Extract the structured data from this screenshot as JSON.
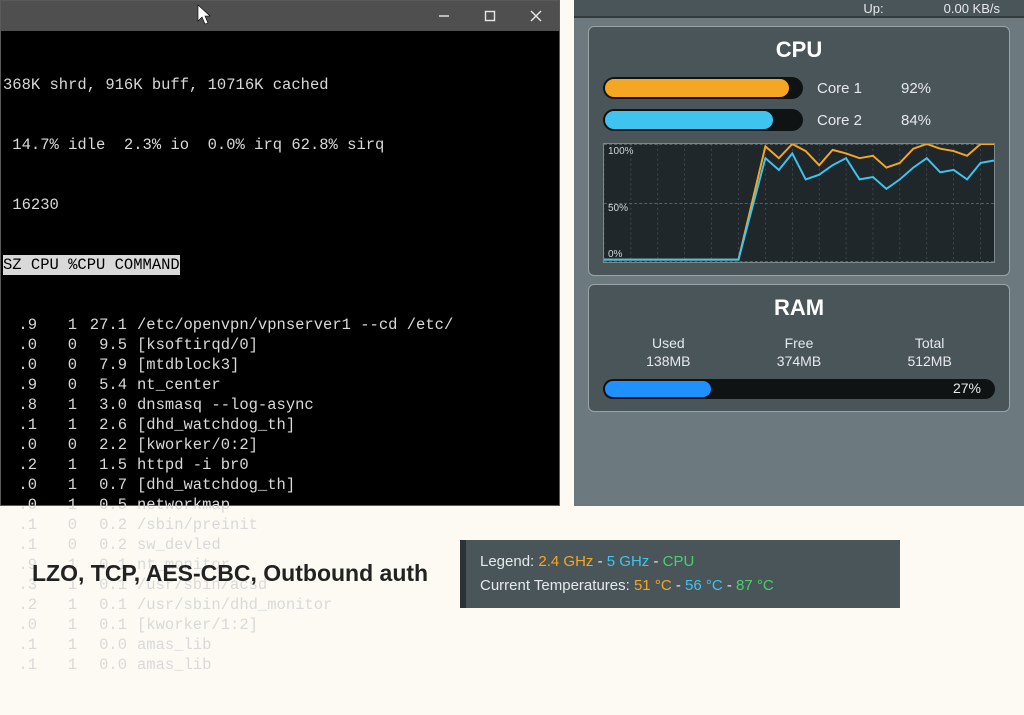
{
  "terminal": {
    "mem_line": "368K shrd, 916K buff, 10716K cached",
    "cpu_line": " 14.7% idle  2.3% io  0.0% irq 62.8% sirq",
    "pid_line": " 16230",
    "header": "SZ CPU %CPU COMMAND",
    "procs": [
      {
        "sz": ".9",
        "cpu": "1",
        "pct": "27.1",
        "cmd": "/etc/openvpn/vpnserver1 --cd /etc/"
      },
      {
        "sz": ".0",
        "cpu": "0",
        "pct": "9.5",
        "cmd": "[ksoftirqd/0]"
      },
      {
        "sz": ".0",
        "cpu": "0",
        "pct": "7.9",
        "cmd": "[mtdblock3]"
      },
      {
        "sz": ".9",
        "cpu": "0",
        "pct": "5.4",
        "cmd": "nt_center"
      },
      {
        "sz": ".8",
        "cpu": "1",
        "pct": "3.0",
        "cmd": "dnsmasq --log-async"
      },
      {
        "sz": ".1",
        "cpu": "1",
        "pct": "2.6",
        "cmd": "[dhd_watchdog_th]"
      },
      {
        "sz": ".0",
        "cpu": "0",
        "pct": "2.2",
        "cmd": "[kworker/0:2]"
      },
      {
        "sz": ".2",
        "cpu": "1",
        "pct": "1.5",
        "cmd": "httpd -i br0"
      },
      {
        "sz": ".0",
        "cpu": "1",
        "pct": "0.7",
        "cmd": "[dhd_watchdog_th]"
      },
      {
        "sz": ".0",
        "cpu": "1",
        "pct": "0.5",
        "cmd": "networkmap"
      },
      {
        "sz": ".1",
        "cpu": "0",
        "pct": "0.2",
        "cmd": "/sbin/preinit"
      },
      {
        "sz": ".1",
        "cpu": "0",
        "pct": "0.2",
        "cmd": "sw_devled"
      },
      {
        "sz": ".9",
        "cpu": "1",
        "pct": "0.1",
        "cmd": "nt_monitor"
      },
      {
        "sz": ".3",
        "cpu": "1",
        "pct": "0.1",
        "cmd": "/usr/sbin/acsd"
      },
      {
        "sz": ".2",
        "cpu": "1",
        "pct": "0.1",
        "cmd": "/usr/sbin/dhd_monitor"
      },
      {
        "sz": ".0",
        "cpu": "1",
        "pct": "0.1",
        "cmd": "[kworker/1:2]"
      },
      {
        "sz": ".1",
        "cpu": "1",
        "pct": "0.0",
        "cmd": "amas_lib"
      },
      {
        "sz": ".1",
        "cpu": "1",
        "pct": "0.0",
        "cmd": "amas_lib"
      }
    ]
  },
  "cpu": {
    "title": "CPU",
    "cores": [
      {
        "name": "Core 1",
        "pct": 92,
        "color": "orange"
      },
      {
        "name": "Core 2",
        "pct": 84,
        "color": "blue"
      }
    ]
  },
  "chart_data": {
    "type": "line",
    "ylim": [
      0,
      100
    ],
    "yticks": [
      "100%",
      "50%",
      "0%"
    ],
    "x": [
      0,
      1,
      2,
      3,
      4,
      5,
      6,
      7,
      8,
      9,
      10,
      11,
      12,
      13,
      14,
      15,
      16,
      17,
      18,
      19,
      20,
      21,
      22,
      23,
      24,
      25,
      26,
      27,
      28,
      29
    ],
    "series": [
      {
        "name": "Core 1",
        "color": "#f5a623",
        "values": [
          2,
          2,
          2,
          2,
          2,
          2,
          2,
          2,
          2,
          2,
          2,
          50,
          98,
          88,
          100,
          94,
          82,
          95,
          92,
          88,
          90,
          80,
          84,
          96,
          100,
          96,
          94,
          90,
          100,
          100
        ]
      },
      {
        "name": "Core 2",
        "color": "#3fc4ef",
        "values": [
          2,
          2,
          2,
          2,
          2,
          2,
          2,
          2,
          2,
          2,
          2,
          45,
          88,
          78,
          92,
          70,
          74,
          82,
          88,
          70,
          72,
          62,
          70,
          80,
          88,
          76,
          78,
          70,
          84,
          86
        ]
      }
    ]
  },
  "ram": {
    "title": "RAM",
    "used_label": "Used",
    "used": "138MB",
    "free_label": "Free",
    "free": "374MB",
    "total_label": "Total",
    "total": "512MB",
    "pct": 27
  },
  "topstrip": {
    "up_label": "Up:",
    "rate": "0.00 KB/s"
  },
  "caption": "LZO, TCP, AES-CBC, Outbound auth",
  "legend": {
    "label": "Legend:",
    "items": [
      {
        "text": "2.4 GHz",
        "cls": "c-orange"
      },
      {
        "text": "5 GHz",
        "cls": "c-blue"
      },
      {
        "text": "CPU",
        "cls": "c-green"
      }
    ],
    "temps_label": "Current Temperatures:",
    "temps": [
      {
        "text": "51 °C",
        "cls": "c-orange"
      },
      {
        "text": "56 °C",
        "cls": "c-blue"
      },
      {
        "text": "87 °C",
        "cls": "c-green"
      }
    ]
  }
}
